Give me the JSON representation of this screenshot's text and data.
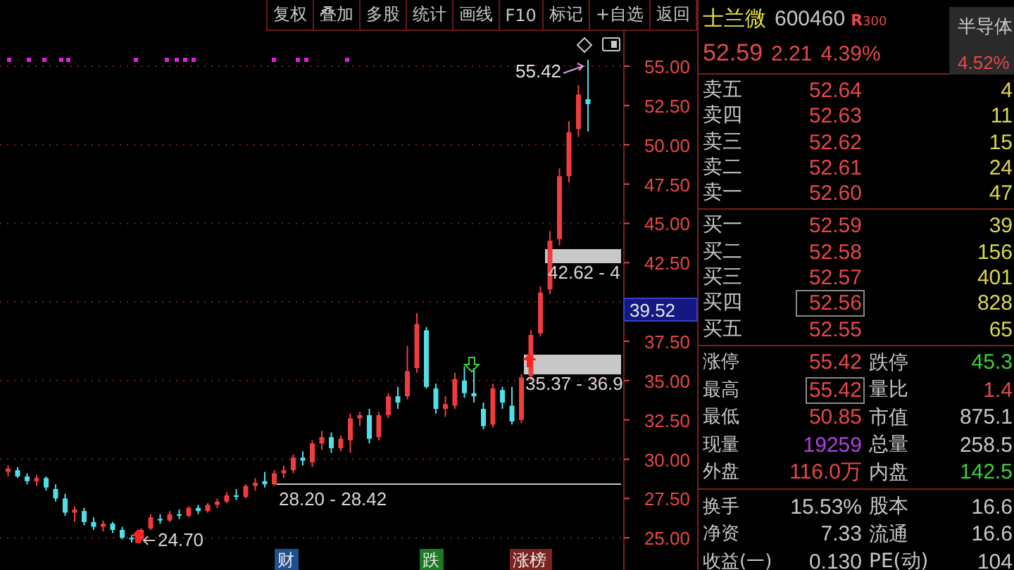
{
  "toolbar": [
    "复权",
    "叠加",
    "多股",
    "统计",
    "画线",
    "F10",
    "标记",
    "+自选",
    "返回"
  ],
  "chart": {
    "current_price": "39.52",
    "annotations": [
      {
        "kind": "peak",
        "text": "55.42"
      },
      {
        "kind": "zone",
        "text": "42.62 - 4"
      },
      {
        "kind": "zone",
        "text": "35.37 - 36.9"
      },
      {
        "kind": "line",
        "text": "28.20 - 28.42"
      },
      {
        "kind": "low",
        "text": "24.70"
      }
    ],
    "event_tags": [
      {
        "text": "财",
        "color": "#1e4f8f"
      },
      {
        "text": "跌",
        "color": "#1d7a24"
      },
      {
        "text": "涨榜",
        "color": "#7a2320"
      }
    ],
    "chart_data": {
      "type": "candlestick",
      "grid": true,
      "ohlc": [
        [
          29.2,
          29.6,
          28.9,
          29.4
        ],
        [
          29.3,
          29.5,
          28.8,
          28.9
        ],
        [
          28.9,
          29.1,
          28.4,
          28.6
        ],
        [
          28.6,
          29.0,
          28.3,
          28.8
        ],
        [
          28.8,
          28.9,
          28.0,
          28.2
        ],
        [
          28.1,
          28.4,
          27.3,
          27.5
        ],
        [
          27.5,
          27.8,
          26.4,
          26.6
        ],
        [
          26.6,
          27.0,
          26.0,
          26.8
        ],
        [
          26.7,
          26.9,
          25.8,
          26.0
        ],
        [
          26.0,
          26.3,
          25.5,
          25.7
        ],
        [
          25.7,
          26.1,
          25.4,
          25.9
        ],
        [
          25.9,
          26.0,
          25.3,
          25.5
        ],
        [
          25.5,
          25.7,
          24.9,
          25.0
        ],
        [
          25.0,
          25.2,
          24.7,
          24.9
        ],
        [
          24.9,
          25.6,
          24.8,
          25.5
        ],
        [
          25.6,
          26.5,
          25.5,
          26.3
        ],
        [
          26.2,
          26.5,
          25.9,
          26.1
        ],
        [
          26.1,
          26.7,
          26.0,
          26.5
        ],
        [
          26.5,
          26.8,
          26.2,
          26.4
        ],
        [
          26.4,
          27.0,
          26.3,
          26.9
        ],
        [
          26.9,
          27.1,
          26.5,
          26.7
        ],
        [
          26.7,
          27.2,
          26.6,
          27.1
        ],
        [
          27.1,
          27.5,
          26.9,
          27.3
        ],
        [
          27.3,
          27.9,
          27.2,
          27.7
        ],
        [
          27.7,
          28.1,
          27.4,
          27.6
        ],
        [
          27.6,
          28.4,
          27.5,
          28.3
        ],
        [
          28.3,
          28.8,
          28.0,
          28.5
        ],
        [
          28.6,
          29.2,
          28.2,
          28.4
        ],
        [
          28.4,
          29.3,
          28.3,
          29.1
        ],
        [
          29.1,
          29.6,
          28.8,
          29.3
        ],
        [
          29.3,
          30.3,
          29.1,
          30.1
        ],
        [
          30.1,
          30.5,
          29.6,
          29.9
        ],
        [
          29.8,
          31.2,
          29.5,
          31.0
        ],
        [
          31.0,
          31.8,
          30.6,
          31.4
        ],
        [
          31.4,
          31.7,
          30.4,
          30.7
        ],
        [
          30.7,
          31.5,
          30.5,
          31.3
        ],
        [
          31.2,
          32.9,
          30.4,
          32.6
        ],
        [
          32.6,
          33.0,
          32.1,
          32.8
        ],
        [
          32.8,
          33.2,
          31.0,
          31.3
        ],
        [
          31.4,
          33.0,
          31.2,
          32.8
        ],
        [
          32.8,
          34.2,
          32.6,
          34.0
        ],
        [
          34.0,
          34.6,
          33.2,
          33.6
        ],
        [
          34.0,
          37.2,
          33.8,
          35.6
        ],
        [
          35.8,
          39.3,
          35.5,
          38.6
        ],
        [
          38.2,
          38.4,
          34.5,
          34.6
        ],
        [
          34.5,
          34.8,
          32.9,
          33.2
        ],
        [
          33.2,
          34.0,
          32.7,
          33.5
        ],
        [
          33.4,
          35.5,
          33.2,
          35.1
        ],
        [
          35.0,
          35.9,
          33.9,
          34.2
        ],
        [
          34.2,
          35.8,
          33.6,
          34.0
        ],
        [
          33.2,
          33.6,
          31.9,
          32.1
        ],
        [
          32.2,
          34.8,
          32.0,
          34.5
        ],
        [
          34.4,
          34.6,
          33.2,
          33.6
        ],
        [
          33.4,
          34.6,
          32.2,
          32.4
        ],
        [
          32.5,
          35.4,
          32.3,
          35.2
        ],
        [
          35.3,
          38.2,
          35.0,
          37.9
        ],
        [
          38.0,
          41.0,
          37.8,
          40.6
        ],
        [
          40.8,
          44.5,
          40.5,
          43.9
        ],
        [
          44.0,
          48.5,
          43.6,
          48.0
        ],
        [
          48.0,
          51.5,
          47.6,
          50.8
        ],
        [
          51.0,
          53.8,
          50.5,
          53.2
        ],
        [
          52.9,
          55.42,
          50.85,
          52.59
        ]
      ],
      "ylim": [
        22.95,
        57.24
      ],
      "yticks": [
        {
          "value": 55,
          "label": "55.00"
        },
        {
          "value": 52.5,
          "label": "52.50"
        },
        {
          "value": 50,
          "label": "50.00"
        },
        {
          "value": 47.5,
          "label": "47.50"
        },
        {
          "value": 45,
          "label": "45.00"
        },
        {
          "value": 42.5,
          "label": "42.50"
        },
        {
          "value": 37.5,
          "label": "37.50"
        },
        {
          "value": 35,
          "label": "35.00"
        },
        {
          "value": 32.5,
          "label": "32.50"
        },
        {
          "value": 30,
          "label": "30.00"
        },
        {
          "value": 27.5,
          "label": "27.50"
        },
        {
          "value": 25,
          "label": "25.00"
        }
      ]
    }
  },
  "quote": {
    "name": "士兰微",
    "code": "600460",
    "badge_letter": "R",
    "badge_number": "300",
    "price": "52.59",
    "change": "2.21",
    "change_pct": "4.39%",
    "sector": {
      "name": "半导体",
      "change_pct": "4.52%"
    },
    "asks": [
      {
        "label": "卖五",
        "price": "52.64",
        "volume": "4",
        "selected": false
      },
      {
        "label": "卖四",
        "price": "52.63",
        "volume": "11",
        "selected": false
      },
      {
        "label": "卖三",
        "price": "52.62",
        "volume": "15",
        "selected": false
      },
      {
        "label": "卖二",
        "price": "52.61",
        "volume": "24",
        "selected": false
      },
      {
        "label": "卖一",
        "price": "52.60",
        "volume": "47",
        "selected": false
      }
    ],
    "bids": [
      {
        "label": "买一",
        "price": "52.59",
        "volume": "39",
        "selected": false
      },
      {
        "label": "买二",
        "price": "52.58",
        "volume": "156",
        "selected": false
      },
      {
        "label": "买三",
        "price": "52.57",
        "volume": "401",
        "selected": false
      },
      {
        "label": "买四",
        "price": "52.56",
        "volume": "828",
        "selected": true
      },
      {
        "label": "买五",
        "price": "52.55",
        "volume": "65",
        "selected": false
      }
    ],
    "stats": [
      {
        "cells": [
          {
            "label": "涨停",
            "value": "55.42",
            "color": "#e8474a",
            "highlighted": false
          },
          {
            "label": "跌停",
            "value": "45.3",
            "color": "#3ad03a",
            "highlighted": false
          }
        ]
      },
      {
        "cells": [
          {
            "label": "最高",
            "value": "55.42",
            "color": "#e8474a",
            "highlighted": true
          },
          {
            "label": "量比",
            "value": "1.4",
            "color": "#e8474a",
            "highlighted": false
          }
        ]
      },
      {
        "cells": [
          {
            "label": "最低",
            "value": "50.85",
            "color": "#e8474a",
            "highlighted": false
          },
          {
            "label": "市值",
            "value": "875.1",
            "color": "#c8c8c8",
            "highlighted": false
          }
        ]
      },
      {
        "cells": [
          {
            "label": "现量",
            "value": "19259",
            "color": "#b040e0",
            "highlighted": false
          },
          {
            "label": "总量",
            "value": "258.5",
            "color": "#c8c8c8",
            "highlighted": false
          }
        ]
      },
      {
        "cells": [
          {
            "label": "外盘",
            "value": "116.0万",
            "color": "#e8474a",
            "highlighted": false
          },
          {
            "label": "内盘",
            "value": "142.5",
            "color": "#3ad03a",
            "highlighted": false
          }
        ]
      }
    ],
    "fundamentals": [
      {
        "label": "换手",
        "value": "15.53%",
        "label2": "股本",
        "value2": "16.6"
      },
      {
        "label": "净资",
        "value": "7.33",
        "label2": "流通",
        "value2": "16.6"
      },
      {
        "label": "收益(一)",
        "value": "0.130",
        "label2": "PE(动)",
        "value2": "104"
      }
    ]
  }
}
